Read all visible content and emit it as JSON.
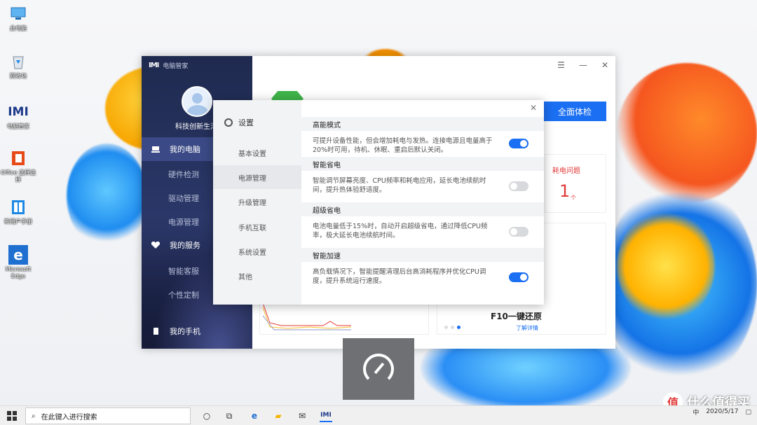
{
  "desktop": {
    "icons": [
      {
        "label": "此电脑",
        "icon": "computer-icon"
      },
      {
        "label": "回收站",
        "icon": "recycle-bin-icon"
      },
      {
        "label": "电脑管家",
        "icon": "pc-manager-icon"
      },
      {
        "label": "Office 选择选择",
        "icon": "office-icon"
      },
      {
        "label": "新用户手册",
        "icon": "manual-icon"
      },
      {
        "label": "Microsoft Edge",
        "icon": "edge-icon"
      }
    ]
  },
  "window": {
    "brand": "电脑管家",
    "username": "科技创新生活",
    "nav": {
      "my_pc": "我的电脑",
      "hardware": "硬件检测",
      "driver": "驱动管理",
      "power": "电源管理",
      "my_service": "我的服务",
      "support": "智能客服",
      "custom": "个性定制",
      "my_phone": "我的手机"
    },
    "scan_button": "全面体检",
    "power_issue_title": "耗电问题",
    "power_issue_count": "1",
    "power_issue_unit": "个",
    "restore_title": "F10一键还原",
    "restore_link": "了解详情"
  },
  "settings": {
    "title": "设置",
    "menu": [
      "基本设置",
      "电源管理",
      "升级管理",
      "手机互联",
      "系统设置",
      "其他"
    ],
    "active_menu": "电源管理",
    "sections": [
      {
        "heading": "高能模式",
        "desc": "可提升设备性能，但会增加耗电与发热。连接电源且电量高于20%时可用，待机、休眠、重启后默认关闭。",
        "enabled": true
      },
      {
        "heading": "智能省电",
        "desc": "智能调节屏幕亮度、CPU频率和耗电应用，延长电池续航时间，提升热体验舒适度。",
        "enabled": false
      },
      {
        "heading": "超级省电",
        "desc": "电池电量低于15%时，自动开启超级省电，通过降低CPU频率，极大延长电池续航时间。",
        "enabled": false
      },
      {
        "heading": "智能加速",
        "desc": "高负载情况下，智能提醒清理后台高消耗程序并优化CPU调度，提升系统运行速度。",
        "enabled": true
      }
    ]
  },
  "taskbar": {
    "search_placeholder": "在此键入进行搜索",
    "ime": "中",
    "date": "2020/5/17"
  },
  "watermark": {
    "text": "什么值得买",
    "glyph": "值"
  }
}
